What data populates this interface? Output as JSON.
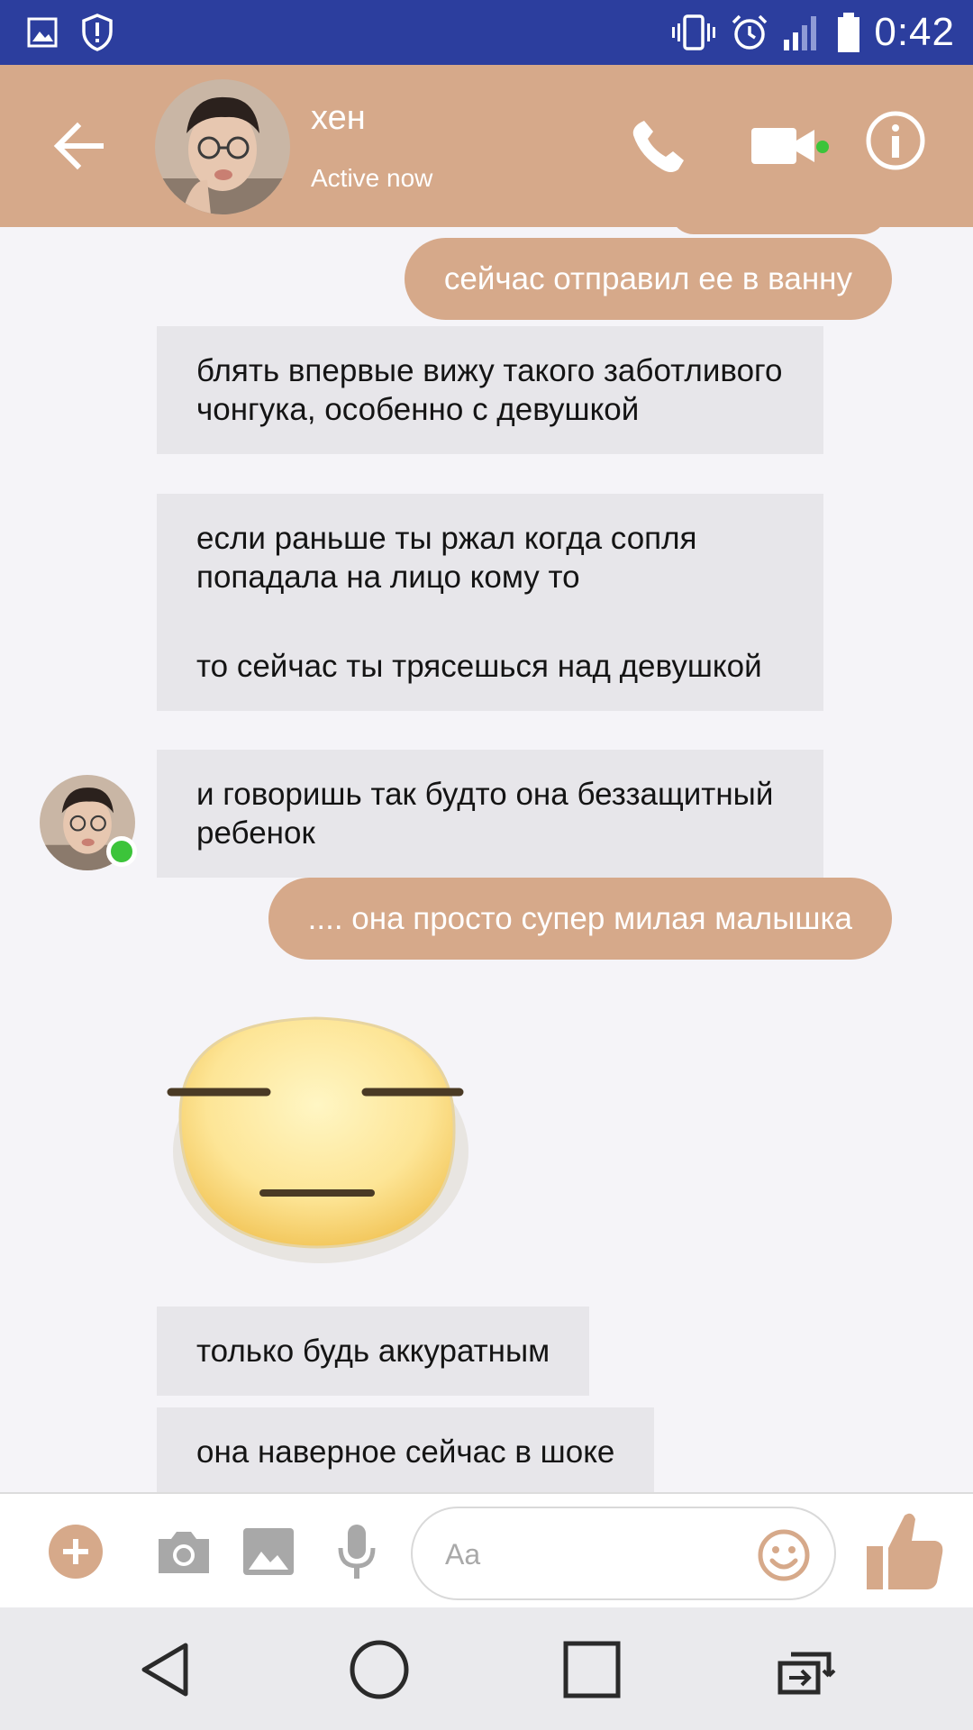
{
  "status_bar": {
    "time": "0:42",
    "left_icons": [
      "gallery-icon",
      "shield-icon"
    ],
    "right_icons": [
      "vibrate-icon",
      "alarm-icon",
      "signal-icon",
      "battery-icon"
    ]
  },
  "header": {
    "contact_name": "хен",
    "contact_status": "Active now",
    "accent_color": "#d6a98a"
  },
  "messages": [
    {
      "side": "out",
      "text": "сейчас отправил ее в ванну"
    },
    {
      "side": "in",
      "text": "блять впервые вижу такого заботливого чонгука, особенно с девушкой"
    },
    {
      "side": "in",
      "text": "если раньше ты ржал когда сопля попадала на лицо кому то"
    },
    {
      "side": "in",
      "text": "то сейчас ты трясешься над девушкой"
    },
    {
      "side": "in",
      "text": "и говоришь так будто она беззащитный ребенок"
    },
    {
      "side": "out",
      "text": ".... она просто супер милая малышка"
    },
    {
      "side": "in",
      "sticker": "expressionless-face"
    },
    {
      "side": "in",
      "text": "только будь аккуратным"
    },
    {
      "side": "in",
      "text": "она наверное сейчас в шоке"
    }
  ],
  "composer": {
    "placeholder": "Aa"
  },
  "colors": {
    "outgoing_bubble": "#d6a98a",
    "incoming_bubble": "#e7e6ea",
    "status_bar": "#2c3e9e",
    "online": "#3cc43a"
  }
}
